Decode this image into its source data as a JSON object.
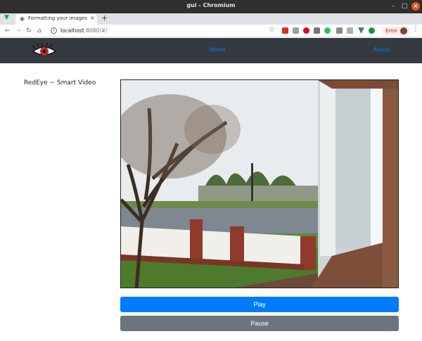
{
  "window": {
    "title": "gui - Chromium"
  },
  "tabs": [
    {
      "title": "Formatting your images f"
    }
  ],
  "address": {
    "host": "localhost",
    "rest": ":8080/#/"
  },
  "extensions": {
    "error_label": "Error"
  },
  "app": {
    "nav": {
      "home_label": "Home",
      "about_label": "About"
    },
    "brand_title": "RedEye ~ Smart Video"
  },
  "controls": {
    "play_label": "Play",
    "pause_label": "Pause"
  },
  "icons": {
    "logo": "red-eye-logo",
    "tab_favicon": "eye-icon",
    "back": "back-arrow-icon",
    "forward": "forward-arrow-icon",
    "reload": "reload-icon",
    "home": "home-icon",
    "bookmark": "star-icon"
  },
  "colors": {
    "navbar_bg": "#343a40",
    "nav_link": "#007bff",
    "play_button": "#007bff",
    "pause_button": "#6c757d"
  }
}
